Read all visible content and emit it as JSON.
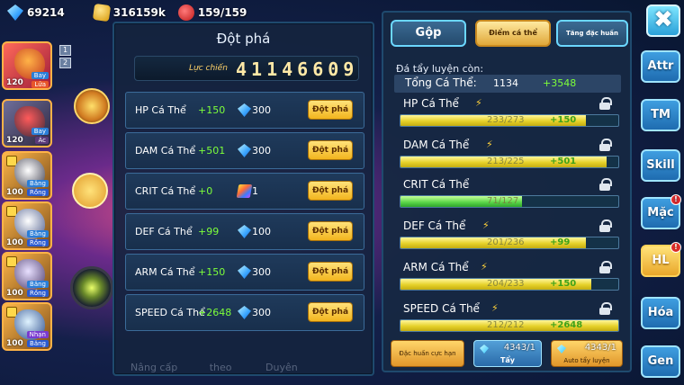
{
  "topbar": {
    "gems": "69214",
    "gold": "316159k",
    "stamina": "159/159"
  },
  "team": {
    "slots": [
      {
        "level": "120",
        "tag1": "Bay",
        "tag2": "Lửa"
      },
      {
        "level": "120",
        "tag1": "Bay",
        "tag2": "Ác"
      },
      {
        "level": "100",
        "tag1": "Băng",
        "tag2": "Rồng"
      },
      {
        "level": "100",
        "tag1": "Băng",
        "tag2": "Rồng"
      },
      {
        "level": "100",
        "tag1": "Băng",
        "tag2": "Rồng"
      },
      {
        "level": "100",
        "tag1": "Nhạn",
        "tag2": "Băng"
      }
    ],
    "side_numbers": [
      "1",
      "2"
    ]
  },
  "breakthrough": {
    "title": "Đột phá",
    "power_label": "Lực chiến",
    "power_value": "41146609",
    "button_label": "Đột phá",
    "rows": [
      {
        "name": "HP Cá Thể",
        "bonus": "+150",
        "cost": "300",
        "cost_icon": "diamond-icon"
      },
      {
        "name": "DAM Cá Thể",
        "bonus": "+501",
        "cost": "300",
        "cost_icon": "diamond-icon"
      },
      {
        "name": "CRIT Cá Thể",
        "bonus": "+0",
        "cost": "1",
        "cost_icon": "scroll-icon"
      },
      {
        "name": "DEF Cá Thể",
        "bonus": "+99",
        "cost": "100",
        "cost_icon": "diamond-icon"
      },
      {
        "name": "ARM Cá Thể",
        "bonus": "+150",
        "cost": "300",
        "cost_icon": "diamond-icon"
      },
      {
        "name": "SPEED Cá Thể",
        "bonus": "+2648",
        "cost": "300",
        "cost_icon": "diamond-icon"
      }
    ],
    "bottom_tabs": [
      "Nâng cấp",
      "theo",
      "Duyên"
    ]
  },
  "training": {
    "tabs": {
      "merge": "Gộp",
      "individual_points": "Điểm cá thể",
      "special_training": "Tăng đặc huấn"
    },
    "remaining_label": "Đá tẩy luyện còn:",
    "total_label": "Tổng Cá Thể:",
    "total_value": "1134",
    "total_plus": "+3548",
    "stats": [
      {
        "name": "HP Cá Thể",
        "value": "233/273",
        "plus": "+150",
        "fill": 0.853,
        "color": "yellow",
        "bolt": true
      },
      {
        "name": "DAM Cá Thể",
        "value": "213/225",
        "plus": "+501",
        "fill": 0.947,
        "color": "yellow",
        "bolt": true
      },
      {
        "name": "CRIT Cá Thể",
        "value": "71/127",
        "plus": "",
        "fill": 0.559,
        "color": "green",
        "bolt": false
      },
      {
        "name": "DEF Cá Thể",
        "value": "201/236",
        "plus": "+99",
        "fill": 0.852,
        "color": "yellow",
        "bolt": true
      },
      {
        "name": "ARM Cá Thể",
        "value": "204/233",
        "plus": "+150",
        "fill": 0.876,
        "color": "yellow",
        "bolt": true
      },
      {
        "name": "SPEED Cá Thể",
        "value": "212/212",
        "plus": "+2648",
        "fill": 1.0,
        "color": "yellow",
        "bolt": true
      }
    ],
    "buttons": {
      "special": "Đặc huấn cực hạn",
      "wash_count": "4343/1",
      "wash": "Tẩy",
      "auto_count": "4343/1",
      "auto": "Auto tẩy luyện"
    }
  },
  "side_nav": {
    "close": "✖",
    "items": [
      {
        "label": "Attr",
        "badge": false,
        "active": false
      },
      {
        "label": "TM",
        "badge": false,
        "active": false
      },
      {
        "label": "Skill",
        "badge": false,
        "active": false
      },
      {
        "label": "Mặc",
        "badge": true,
        "active": false
      },
      {
        "label": "HL",
        "badge": true,
        "active": true
      },
      {
        "label": "Hóa",
        "badge": false,
        "active": false
      },
      {
        "label": "Gen",
        "badge": false,
        "active": false
      }
    ],
    "badge_text": "!"
  },
  "colors": {
    "accent_green": "#7dff3a",
    "accent_gold": "#f2b51e",
    "panel_bg": "#14243e",
    "nav_blue": "#1f6cb0"
  }
}
